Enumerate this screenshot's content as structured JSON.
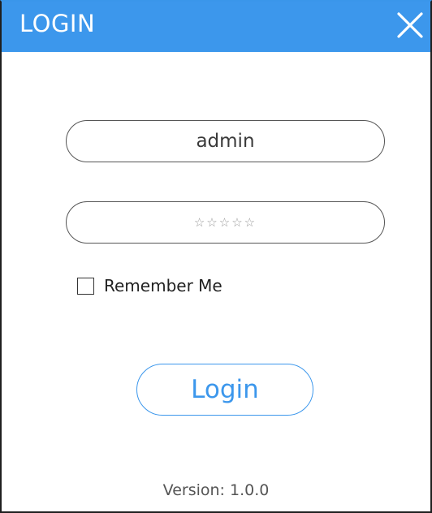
{
  "window": {
    "title": "LOGIN",
    "accent_color": "#3c97ec",
    "close_icon": "close-icon"
  },
  "form": {
    "username": {
      "value": "admin",
      "placeholder": ""
    },
    "password": {
      "value": "☆☆☆☆☆",
      "placeholder": ""
    },
    "remember_me": {
      "label": "Remember Me",
      "checked": false
    },
    "login_label": "Login"
  },
  "footer": {
    "version": "Version: 1.0.0"
  }
}
